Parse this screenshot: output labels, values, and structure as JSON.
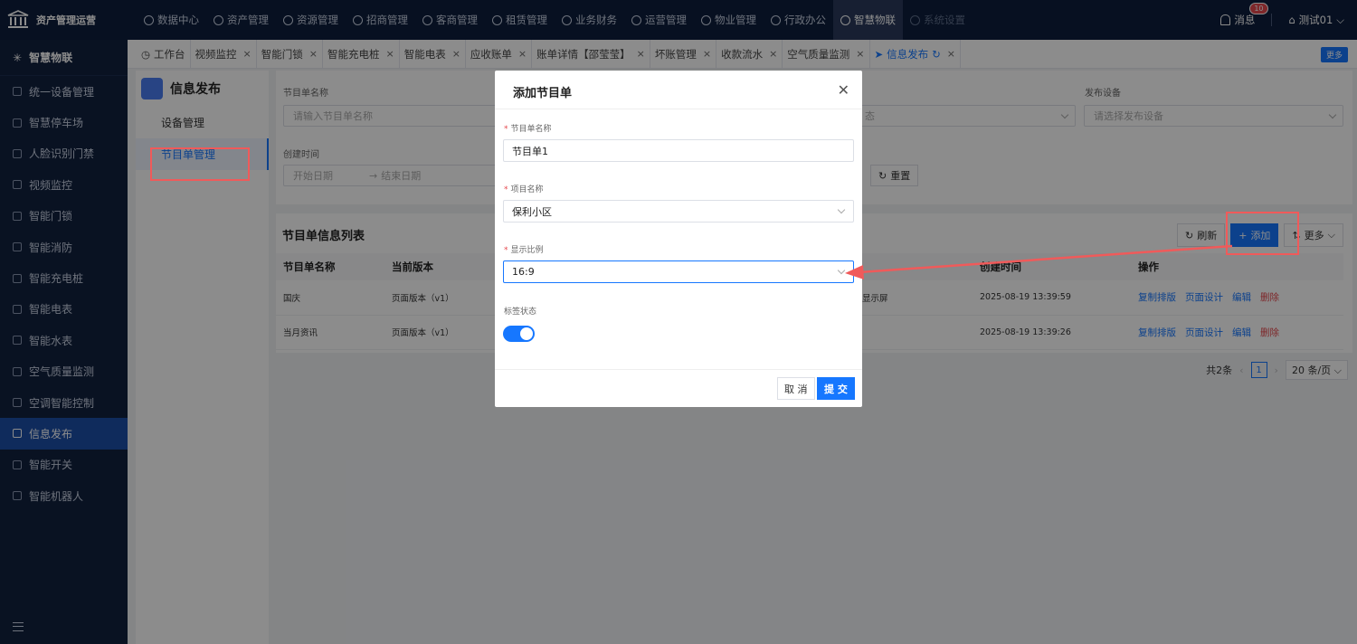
{
  "app": {
    "title": "资产管理运营"
  },
  "nav": {
    "items": [
      {
        "label": "数据中心",
        "icon": "clock-icon"
      },
      {
        "label": "资产管理",
        "icon": "cube-icon"
      },
      {
        "label": "资源管理",
        "icon": "building-icon"
      },
      {
        "label": "招商管理",
        "icon": "tag-icon"
      },
      {
        "label": "客商管理",
        "icon": "users-icon"
      },
      {
        "label": "租赁管理",
        "icon": "house-icon"
      },
      {
        "label": "业务财务",
        "icon": "coin-icon"
      },
      {
        "label": "运营管理",
        "icon": "chart-icon"
      },
      {
        "label": "物业管理",
        "icon": "home-icon"
      },
      {
        "label": "行政办公",
        "icon": "monitor-icon"
      },
      {
        "label": "智慧物联",
        "icon": "iot-icon"
      },
      {
        "label": "系统设置",
        "icon": "gear-icon"
      }
    ]
  },
  "header": {
    "message_label": "消息",
    "message_count": "10",
    "user": "测试01"
  },
  "sidebar": {
    "title": "智慧物联",
    "items": [
      {
        "label": "统一设备管理"
      },
      {
        "label": "智慧停车场"
      },
      {
        "label": "人脸识别门禁"
      },
      {
        "label": "视频监控"
      },
      {
        "label": "智能门锁"
      },
      {
        "label": "智能消防"
      },
      {
        "label": "智能充电桩"
      },
      {
        "label": "智能电表"
      },
      {
        "label": "智能水表"
      },
      {
        "label": "空气质量监测"
      },
      {
        "label": "空调智能控制"
      },
      {
        "label": "信息发布"
      },
      {
        "label": "智能开关"
      },
      {
        "label": "智能机器人"
      }
    ]
  },
  "tabs": {
    "items": [
      {
        "label": "工作台"
      },
      {
        "label": "视频监控"
      },
      {
        "label": "智能门锁"
      },
      {
        "label": "智能充电桩"
      },
      {
        "label": "智能电表"
      },
      {
        "label": "应收账单"
      },
      {
        "label": "账单详情【邵莹莹】"
      },
      {
        "label": "坏账管理"
      },
      {
        "label": "收款流水"
      },
      {
        "label": "空气质量监测"
      },
      {
        "label": "信息发布"
      }
    ],
    "more": "更多"
  },
  "subpanel": {
    "title": "信息发布",
    "items": [
      {
        "label": "设备管理"
      },
      {
        "label": "节目单管理"
      }
    ]
  },
  "filter": {
    "name_label": "节目单名称",
    "name_placeholder": "请输入节目单名称",
    "status_partial": "态",
    "device_label": "发布设备",
    "device_placeholder": "请选择发布设备",
    "created_label": "创建时间",
    "start_placeholder": "开始日期",
    "end_placeholder": "结束日期",
    "reset": "重置"
  },
  "list": {
    "title": "节目单信息列表",
    "refresh": "刷新",
    "add": "添加",
    "more": "更多",
    "columns": {
      "name": "节目单名称",
      "version": "当前版本",
      "created": "创建时间",
      "ops": "操作"
    },
    "rows": [
      {
        "name": "国庆",
        "version": "页面版本（v1）",
        "device_partial": "显示屏",
        "created": "2025-08-19 13:39:59"
      },
      {
        "name": "当月资讯",
        "version": "页面版本（v1）",
        "device_partial": "",
        "created": "2025-08-19 13:39:26"
      }
    ],
    "ops": {
      "copy": "复制排版",
      "design": "页面设计",
      "edit": "编辑",
      "delete": "删除"
    },
    "total": "共2条",
    "page": "1",
    "page_size": "20 条/页"
  },
  "modal": {
    "title": "添加节目单",
    "name_label": "节目单名称",
    "name_value": "节目单1",
    "project_label": "项目名称",
    "project_value": "保利小区",
    "ratio_label": "显示比例",
    "ratio_value": "16:9",
    "status_label": "标签状态",
    "status_on": true,
    "cancel": "取 消",
    "submit": "提 交"
  },
  "colors": {
    "primary": "#1677ff",
    "nav_bg": "#0e1e3c",
    "sidebar_bg": "#12213f",
    "danger": "#e5484d",
    "annotation": "#f05a5a"
  }
}
